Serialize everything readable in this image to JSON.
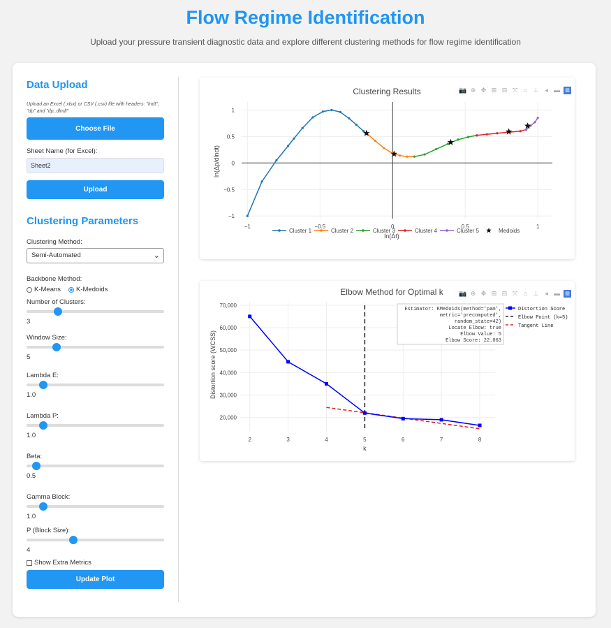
{
  "page": {
    "title": "Flow Regime Identification",
    "subtitle": "Upload your pressure transient diagnostic data and explore different clustering methods for flow regime identification"
  },
  "sidebar": {
    "upload_heading": "Data Upload",
    "upload_help": "Upload an Excel (.xlsx) or CSV (.csv) file with headers: \"lndt\", \"dp\" and \"dp_dlndt\"",
    "choose_file_label": "Choose File",
    "sheet_label": "Sheet Name (for Excel):",
    "sheet_value": "Sheet2",
    "upload_button": "Upload",
    "params_heading": "Clustering Parameters",
    "method_label": "Clustering Method:",
    "method_value": "Semi-Automated",
    "backbone_label": "Backbone Method:",
    "backbone_options": [
      "K-Means",
      "K-Medoids"
    ],
    "backbone_selected": "K-Medoids",
    "sliders": [
      {
        "label": "Number of Clusters:",
        "value": "3",
        "fraction": 0.23
      },
      {
        "label": "Window Size:",
        "value": "5",
        "fraction": 0.22
      },
      {
        "label": "Lambda E:",
        "value": "1.0",
        "fraction": 0.12
      },
      {
        "label": "Lambda P:",
        "value": "1.0",
        "fraction": 0.12
      },
      {
        "label": "Beta:",
        "value": "0.5",
        "fraction": 0.07
      },
      {
        "label": "Gamma Block:",
        "value": "1.0",
        "fraction": 0.12
      },
      {
        "label": "P (Block Size):",
        "value": "4",
        "fraction": 0.34
      }
    ],
    "extra_metrics_label": "Show Extra Metrics",
    "update_button": "Update Plot"
  },
  "colors": {
    "accent": "#2196f3",
    "cluster1": "#1f77b4",
    "cluster2": "#ff7f0e",
    "cluster3": "#2ca02c",
    "cluster4": "#d62728",
    "cluster5": "#9467bd",
    "elbow_line": "#0000ff",
    "tangent": "#e02020"
  },
  "modebar_icons": [
    "camera-icon",
    "zoom-icon",
    "pan-icon",
    "zoom-in-icon",
    "zoom-out-icon",
    "autoscale-icon",
    "home-icon",
    "spike-icon",
    "hover-closest-icon",
    "hover-compare-icon",
    "plotly-logo-icon"
  ],
  "chart_data": [
    {
      "type": "line",
      "title": "Clustering Results",
      "xlabel": "ln(Δt)",
      "ylabel": "ln(Δp/dlndt)",
      "xlim": [
        -1.04,
        1.1
      ],
      "ylim": [
        -1.05,
        1.15
      ],
      "xticks": [
        -1,
        -0.5,
        0,
        0.5,
        1
      ],
      "xtick_labels": [
        "−1",
        "−0.5",
        "0",
        "0.5",
        "1"
      ],
      "yticks": [
        -1,
        -0.5,
        0,
        0.5,
        1
      ],
      "ytick_labels": [
        "−1",
        "−0.5",
        "0",
        "0.5",
        "1"
      ],
      "legend": "bottom",
      "series": [
        {
          "name": "Cluster 1",
          "color": "#1f77b4",
          "x": [
            -1.0,
            -0.9,
            -0.8,
            -0.72,
            -0.68,
            -0.62,
            -0.55,
            -0.48,
            -0.42,
            -0.36,
            -0.3,
            -0.25,
            -0.2,
            -0.18
          ],
          "y": [
            -1.0,
            -0.35,
            0.05,
            0.32,
            0.46,
            0.66,
            0.86,
            0.97,
            1.0,
            0.96,
            0.84,
            0.72,
            0.6,
            0.56
          ]
        },
        {
          "name": "Cluster 2",
          "color": "#ff7f0e",
          "x": [
            -0.18,
            -0.12,
            -0.06,
            0.0,
            0.05,
            0.1,
            0.15
          ],
          "y": [
            0.56,
            0.42,
            0.28,
            0.18,
            0.14,
            0.12,
            0.12
          ]
        },
        {
          "name": "Cluster 3",
          "color": "#2ca02c",
          "x": [
            0.15,
            0.22,
            0.3,
            0.38,
            0.45,
            0.52,
            0.58
          ],
          "y": [
            0.12,
            0.16,
            0.26,
            0.36,
            0.44,
            0.49,
            0.52
          ]
        },
        {
          "name": "Cluster 4",
          "color": "#d62728",
          "x": [
            0.58,
            0.65,
            0.72,
            0.8,
            0.88,
            0.92
          ],
          "y": [
            0.52,
            0.54,
            0.56,
            0.58,
            0.6,
            0.63
          ]
        },
        {
          "name": "Cluster 5",
          "color": "#9467bd",
          "x": [
            0.92,
            0.95,
            0.98,
            1.0
          ],
          "y": [
            0.63,
            0.7,
            0.77,
            0.85
          ]
        }
      ],
      "medoids": {
        "name": "Medoids",
        "x": [
          -0.18,
          0.01,
          0.4,
          0.8,
          0.93
        ],
        "y": [
          0.56,
          0.17,
          0.39,
          0.59,
          0.7
        ]
      }
    },
    {
      "type": "line",
      "title": "Elbow Method for Optimal k",
      "xlabel": "k",
      "ylabel": "Distortion score (WCSS)",
      "xlim": [
        1.75,
        8.4
      ],
      "ylim": [
        14000,
        71500
      ],
      "yticks": [
        20000,
        30000,
        40000,
        50000,
        60000,
        70000
      ],
      "ytick_labels": [
        "20,000",
        "30,000",
        "40,000",
        "50,000",
        "60,000",
        "70,000"
      ],
      "xticks": [
        2,
        3,
        4,
        5,
        6,
        7,
        8
      ],
      "xtick_labels": [
        "2",
        "3",
        "4",
        "5",
        "6",
        "7",
        "8"
      ],
      "series": [
        {
          "name": "Distortion Score",
          "color": "#0000ff",
          "x": [
            2,
            3,
            4,
            5,
            6,
            7,
            8
          ],
          "y": [
            65000,
            44800,
            35000,
            22000,
            19500,
            19000,
            16500
          ]
        }
      ],
      "elbow_point": {
        "name": "Elbow Point (k=5)",
        "x": 5
      },
      "tangent_line": {
        "name": "Tangent Line",
        "x": [
          4,
          8
        ],
        "y": [
          24500,
          15000
        ]
      },
      "annotation_lines": [
        "Estimator: KMedoids(method='pam',",
        "metric='precomputed',",
        "random_state=42)",
        "Locate Elbow: true",
        "Elbow Value: 5",
        "Elbow Score: 22.063"
      ],
      "legend": "top-right"
    }
  ]
}
